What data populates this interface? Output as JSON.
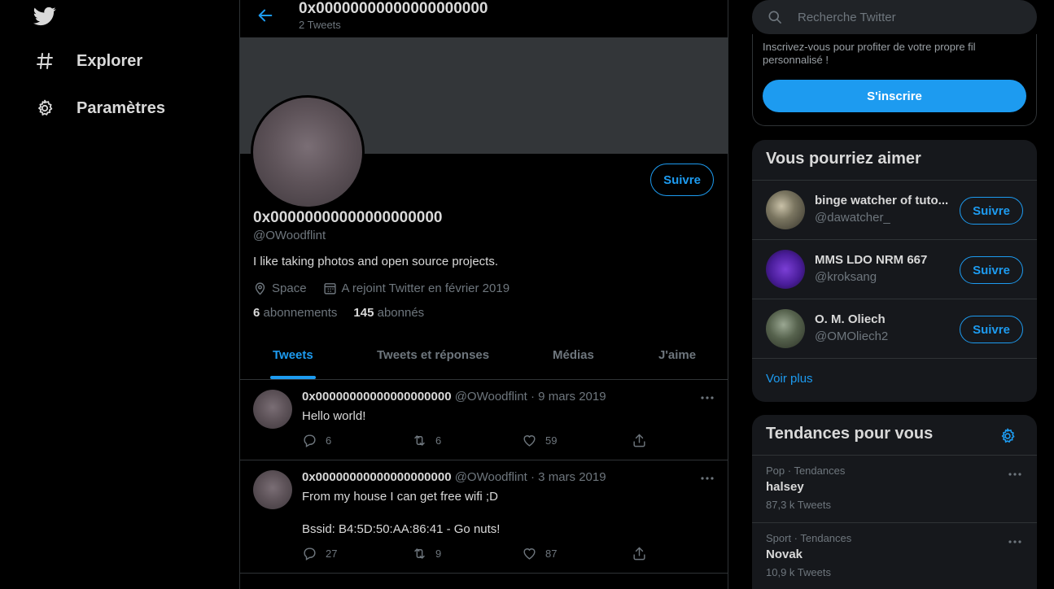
{
  "nav": {
    "items": [
      {
        "label": "Explorer",
        "icon": "hashtag-icon"
      },
      {
        "label": "Paramètres",
        "icon": "gear-icon"
      }
    ]
  },
  "header": {
    "title": "0x00000000000000000000",
    "subtitle": "2 Tweets"
  },
  "profile": {
    "follow_label": "Suivre",
    "name": "0x00000000000000000000",
    "handle": "@OWoodflint",
    "bio": "I like taking photos and open source projects.",
    "location": "Space",
    "joined": "A rejoint Twitter en février 2019",
    "following_count": "6",
    "following_label": "abonnements",
    "followers_count": "145",
    "followers_label": "abonnés"
  },
  "tabs": [
    "Tweets",
    "Tweets et réponses",
    "Médias",
    "J'aime"
  ],
  "tweets": [
    {
      "name": "0x00000000000000000000",
      "meta": "@OWoodflint · 9 mars 2019",
      "text": "Hello world!",
      "replies": "6",
      "retweets": "6",
      "likes": "59"
    },
    {
      "name": "0x00000000000000000000",
      "meta": "@OWoodflint · 3 mars 2019",
      "text_line1": "From my house I can get free wifi ;D",
      "text_line2": "Bssid: B4:5D:50:AA:86:41 - Go nuts!",
      "replies": "27",
      "retweets": "9",
      "likes": "87"
    }
  ],
  "search": {
    "placeholder": "Recherche Twitter"
  },
  "signup": {
    "text": "Inscrivez-vous pour profiter de votre propre fil personnalisé !",
    "button": "S'inscrire"
  },
  "suggestions": {
    "title": "Vous pourriez aimer",
    "items": [
      {
        "name": "binge watcher of tuto...",
        "handle": "@dawatcher_",
        "follow": "Suivre"
      },
      {
        "name": "MMS LDO NRM 667",
        "handle": "@kroksang",
        "follow": "Suivre"
      },
      {
        "name": "O. M. Oliech",
        "handle": "@OMOliech2",
        "follow": "Suivre"
      }
    ],
    "more": "Voir plus"
  },
  "trends": {
    "title": "Tendances pour vous",
    "items": [
      {
        "category": "Pop · Tendances",
        "name": "halsey",
        "count": "87,3 k Tweets"
      },
      {
        "category": "Sport · Tendances",
        "name": "Novak",
        "count": "10,9 k Tweets"
      }
    ]
  },
  "colors": {
    "accent": "#1d9bf0",
    "background": "#000000",
    "card": "#16181c",
    "border": "#2f3336"
  }
}
